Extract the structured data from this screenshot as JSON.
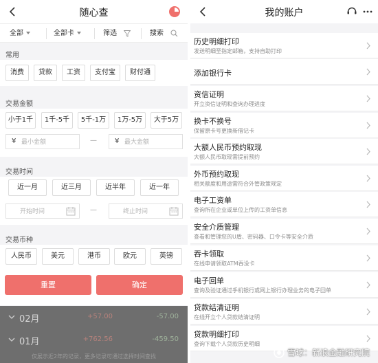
{
  "left": {
    "header": {
      "title": "随心查"
    },
    "filters": {
      "all_label": "全部",
      "card_label": "全部卡",
      "filter_label": "筛选",
      "search_label": "搜索"
    },
    "common": {
      "label": "常用",
      "chips": [
        "消费",
        "贷款",
        "工资",
        "支付宝",
        "财付通"
      ]
    },
    "amount": {
      "label": "交易金额",
      "chips": [
        "小于1千",
        "1千-5千",
        "5千-1万",
        "1万-5万",
        "大于5万"
      ],
      "currency_symbol": "¥",
      "min_placeholder": "最小金额",
      "max_placeholder": "最大金额",
      "separator": "—"
    },
    "time": {
      "label": "交易时间",
      "chips": [
        "近一月",
        "近三月",
        "近半年",
        "近一年"
      ],
      "start_placeholder": "开始时间",
      "end_placeholder": "终止时间",
      "separator": "—"
    },
    "currency": {
      "label": "交易币种",
      "chips": [
        "人民币",
        "美元",
        "港币",
        "欧元",
        "英镑"
      ]
    },
    "actions": {
      "reset": "重置",
      "confirm": "确定"
    },
    "months": [
      {
        "name": "02月",
        "income": "+57.00",
        "expense": "-57.00"
      },
      {
        "name": "01月",
        "income": "+762.56",
        "expense": "-459.50"
      }
    ],
    "notice": "仅展示近2年的记录，更多记录可通过选择时间查找"
  },
  "right": {
    "header": {
      "title": "我的账户"
    },
    "items": [
      {
        "title": "历史明细打印",
        "subtitle": "发送明细至指定邮箱，支持自助打印"
      },
      {
        "title": "添加银行卡",
        "subtitle": ""
      },
      {
        "title": "资信证明",
        "subtitle": "开立资信证明和查询办理进度"
      },
      {
        "title": "换卡不换号",
        "subtitle": "保留原卡号更换新借记卡"
      },
      {
        "title": "大额人民币预约取现",
        "subtitle": "大额人民币取现需提前预约"
      },
      {
        "title": "外币预约取现",
        "subtitle": "相关额度和用途需符合外管政策规定"
      },
      {
        "title": "电子工资单",
        "subtitle": "查询所在企业或单位上传的工资单信息"
      },
      {
        "title": "安全介质管理",
        "subtitle": "查看和管理您的U盾、密码器、口令卡等安全介质"
      },
      {
        "title": "吞卡领取",
        "subtitle": "在线申请领取ATM吞没卡"
      },
      {
        "title": "电子回单",
        "subtitle": "查询及验证通过手机银行或网上银行办理业务的电子回单"
      },
      {
        "title": "贷款结清证明",
        "subtitle": "在线开立个人贷款结清证明"
      },
      {
        "title": "贷款明细打印",
        "subtitle": "查询下载个人贷款历史明细"
      }
    ]
  },
  "watermark": {
    "text": "雪球：新浪金融研究院"
  },
  "colors": {
    "accent": "#ef706c",
    "overlay": "#6e6e6e",
    "background": "#f4f4f6"
  }
}
